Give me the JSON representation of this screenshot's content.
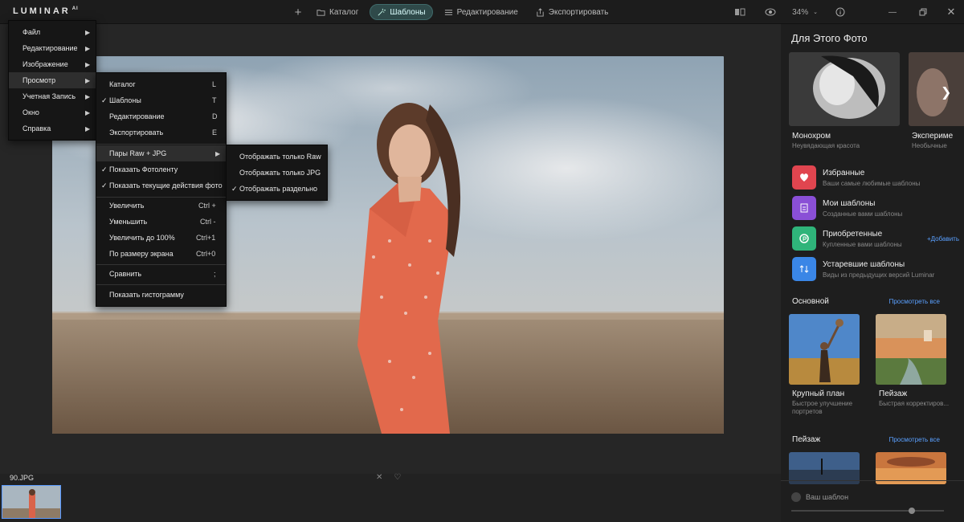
{
  "app": {
    "logo": "LUMINAR",
    "logo_suffix": "AI"
  },
  "nav": {
    "add": "+",
    "catalog": "Каталог",
    "templates": "Шаблоны",
    "edit": "Редактирование",
    "export": "Экспортировать"
  },
  "toolbar": {
    "zoom": "34%"
  },
  "menu_main": [
    "Файл",
    "Редактирование",
    "Изображение",
    "Просмотр",
    "Учетная Запись",
    "Окно",
    "Справка"
  ],
  "menu_view": {
    "items": [
      {
        "label": "Каталог",
        "shortcut": "L",
        "checked": false
      },
      {
        "label": "Шаблоны",
        "shortcut": "T",
        "checked": true
      },
      {
        "label": "Редактирование",
        "shortcut": "D",
        "checked": false
      },
      {
        "label": "Экспортировать",
        "shortcut": "E",
        "checked": false
      },
      {
        "label": "Пары Raw + JPG",
        "shortcut": "",
        "checked": false
      },
      {
        "label": "Показать Фотоленту",
        "shortcut": "",
        "checked": true
      },
      {
        "label": "Показать текущие действия фото",
        "shortcut": "",
        "checked": true
      },
      {
        "label": "Увеличить",
        "shortcut": "Ctrl +",
        "checked": false
      },
      {
        "label": "Уменьшить",
        "shortcut": "Ctrl -",
        "checked": false
      },
      {
        "label": "Увеличить до 100%",
        "shortcut": "Ctrl+1",
        "checked": false
      },
      {
        "label": "По размеру экрана",
        "shortcut": "Ctrl+0",
        "checked": false
      },
      {
        "label": "Сравнить",
        "shortcut": ";",
        "checked": false
      },
      {
        "label": "Показать гистограмму",
        "shortcut": "",
        "checked": false
      }
    ]
  },
  "menu_raw": {
    "items": [
      {
        "label": "Отображать только Raw",
        "checked": false
      },
      {
        "label": "Отображать только JPG",
        "checked": false
      },
      {
        "label": "Отображать раздельно",
        "checked": true
      }
    ]
  },
  "check": "✓",
  "arrow": "▶",
  "filmstrip": {
    "filename": "90.JPG"
  },
  "sidebar": {
    "title": "Для Этого Фото",
    "hero": [
      {
        "title": "Монохром",
        "subtitle": "Неувядающая красота"
      },
      {
        "title": "Экспериме",
        "subtitle": "Необычные"
      }
    ],
    "collections": [
      {
        "title": "Избранные",
        "subtitle": "Ваши самые любимые шаблоны",
        "color": "#e0454f"
      },
      {
        "title": "Мои шаблоны",
        "subtitle": "Созданные вами шаблоны",
        "color": "#8a4fd6"
      },
      {
        "title": "Приобретенные",
        "subtitle": "Купленные вами шаблоны",
        "color": "#2fb47a",
        "action": "+Добавить"
      },
      {
        "title": "Устаревшие шаблоны",
        "subtitle": "Виды из предыдущих версий Luminar",
        "color": "#3a86e6"
      }
    ],
    "section1": {
      "title": "Основной",
      "see_all": "Просмотреть все",
      "cards": [
        {
          "title": "Крупный план",
          "subtitle": "Быстрое улучшение портретов"
        },
        {
          "title": "Пейзаж",
          "subtitle": "Быстрая корректиров..."
        }
      ]
    },
    "section2": {
      "title": "Пейзаж",
      "see_all": "Просмотреть все"
    },
    "your_template": "Ваш шаблон"
  }
}
